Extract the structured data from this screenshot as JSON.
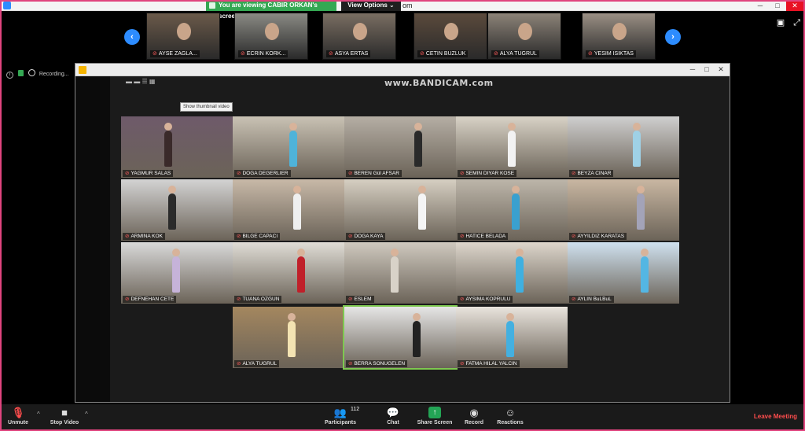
{
  "top_bar": {
    "share_banner": "You are viewing CABIR ORKAN's screen",
    "view_options": "View Options",
    "view_options_caret": "⌄",
    "title_tail": "om"
  },
  "gallery_strip": {
    "participants": [
      {
        "name": "AYSE ZAGLA...",
        "color": "#6b5a4a"
      },
      {
        "name": "ECRIN KORK...",
        "color": "#8a8a84"
      },
      {
        "name": "ASYA ERTAS",
        "color": "#7a6e62"
      },
      {
        "name": "CETIN BUZLUK",
        "color": "#5b4a3c"
      },
      {
        "name": "ALYA TUGRUL",
        "color": "#8c8378"
      },
      {
        "name": "YESIM ISIKTAS",
        "color": "#9a8f84"
      }
    ],
    "prev_arrow": "‹",
    "next_arrow": "›"
  },
  "top_right": {
    "speaker_view_icon": "▣",
    "fullscreen_icon": "⤢"
  },
  "recording": {
    "label": "Recording..."
  },
  "shared_window": {
    "watermark": "www.BANDICAM.com",
    "tooltip": "Show thumbnail video",
    "toolbar_icons": "▬ ▬ ☰ ▦",
    "window_controls": {
      "min": "─",
      "max": "□",
      "close": "✕"
    },
    "tiles": [
      {
        "name": "YAGMUR SALAS",
        "bg": "#6e5a6a",
        "dress": "#3a2a2a"
      },
      {
        "name": "DOGA DEGERLIER",
        "bg": "#c9c2b4",
        "dress": "#4fb3d9"
      },
      {
        "name": "BEREN Gül AFSAR",
        "bg": "#b5aea4",
        "dress": "#2a2a2a"
      },
      {
        "name": "SEMIN DIYAR KOSE",
        "bg": "#d8d2c6",
        "dress": "#f2f2f2"
      },
      {
        "name": "BEYZA CINAR",
        "bg": "#cfcfcf",
        "dress": "#9fd1e6"
      },
      {
        "name": "ARMINA KOK",
        "bg": "#d3d3d3",
        "dress": "#2b2b2b"
      },
      {
        "name": "BILGE CAPACI",
        "bg": "#c8b9a8",
        "dress": "#efefef"
      },
      {
        "name": "DOGA KAYA",
        "bg": "#d6cfc2",
        "dress": "#f5f5f5"
      },
      {
        "name": "HATICE BELADA",
        "bg": "#bdb6aa",
        "dress": "#3aa0cf"
      },
      {
        "name": "AYYILDIZ KARATAS",
        "bg": "#c9b7a2",
        "dress": "#a3a3b8"
      },
      {
        "name": "DEFNEHAN CETE",
        "bg": "#d9d9d9",
        "dress": "#c6b3d9"
      },
      {
        "name": "TUANA OZGUN",
        "bg": "#e0ddd6",
        "dress": "#c0202a"
      },
      {
        "name": "ESLEM",
        "bg": "#cfc9bf",
        "dress": "#d8d2c8"
      },
      {
        "name": "AYSIMA KOPRULU",
        "bg": "#ddd6cc",
        "dress": "#3fb0e0"
      },
      {
        "name": "AYLIN BuLBuL",
        "bg": "#cfe1ef",
        "dress": "#54b6e3"
      },
      {
        "name": "ALYA TUGRUL",
        "bg": "#a4875f",
        "dress": "#f3e3b2"
      },
      {
        "name": "BERRA SONUGELEN",
        "bg": "#e6e6e6",
        "dress": "#222222"
      },
      {
        "name": "FATMA HILAL YALCIN",
        "bg": "#e9e4dd",
        "dress": "#44b0e0"
      }
    ]
  },
  "toolbar": {
    "unmute": {
      "label": "Unmute",
      "icon": "🎙"
    },
    "stop_video": {
      "label": "Stop Video",
      "icon": "■"
    },
    "participants": {
      "label": "Participants",
      "icon": "👥",
      "count": "112"
    },
    "chat": {
      "label": "Chat",
      "icon": "💬"
    },
    "share_screen": {
      "label": "Share Screen",
      "icon": "↑"
    },
    "record": {
      "label": "Record",
      "icon": "◉"
    },
    "reactions": {
      "label": "Reactions",
      "icon": "☺"
    },
    "leave": "Leave Meeting",
    "caret": "^"
  }
}
